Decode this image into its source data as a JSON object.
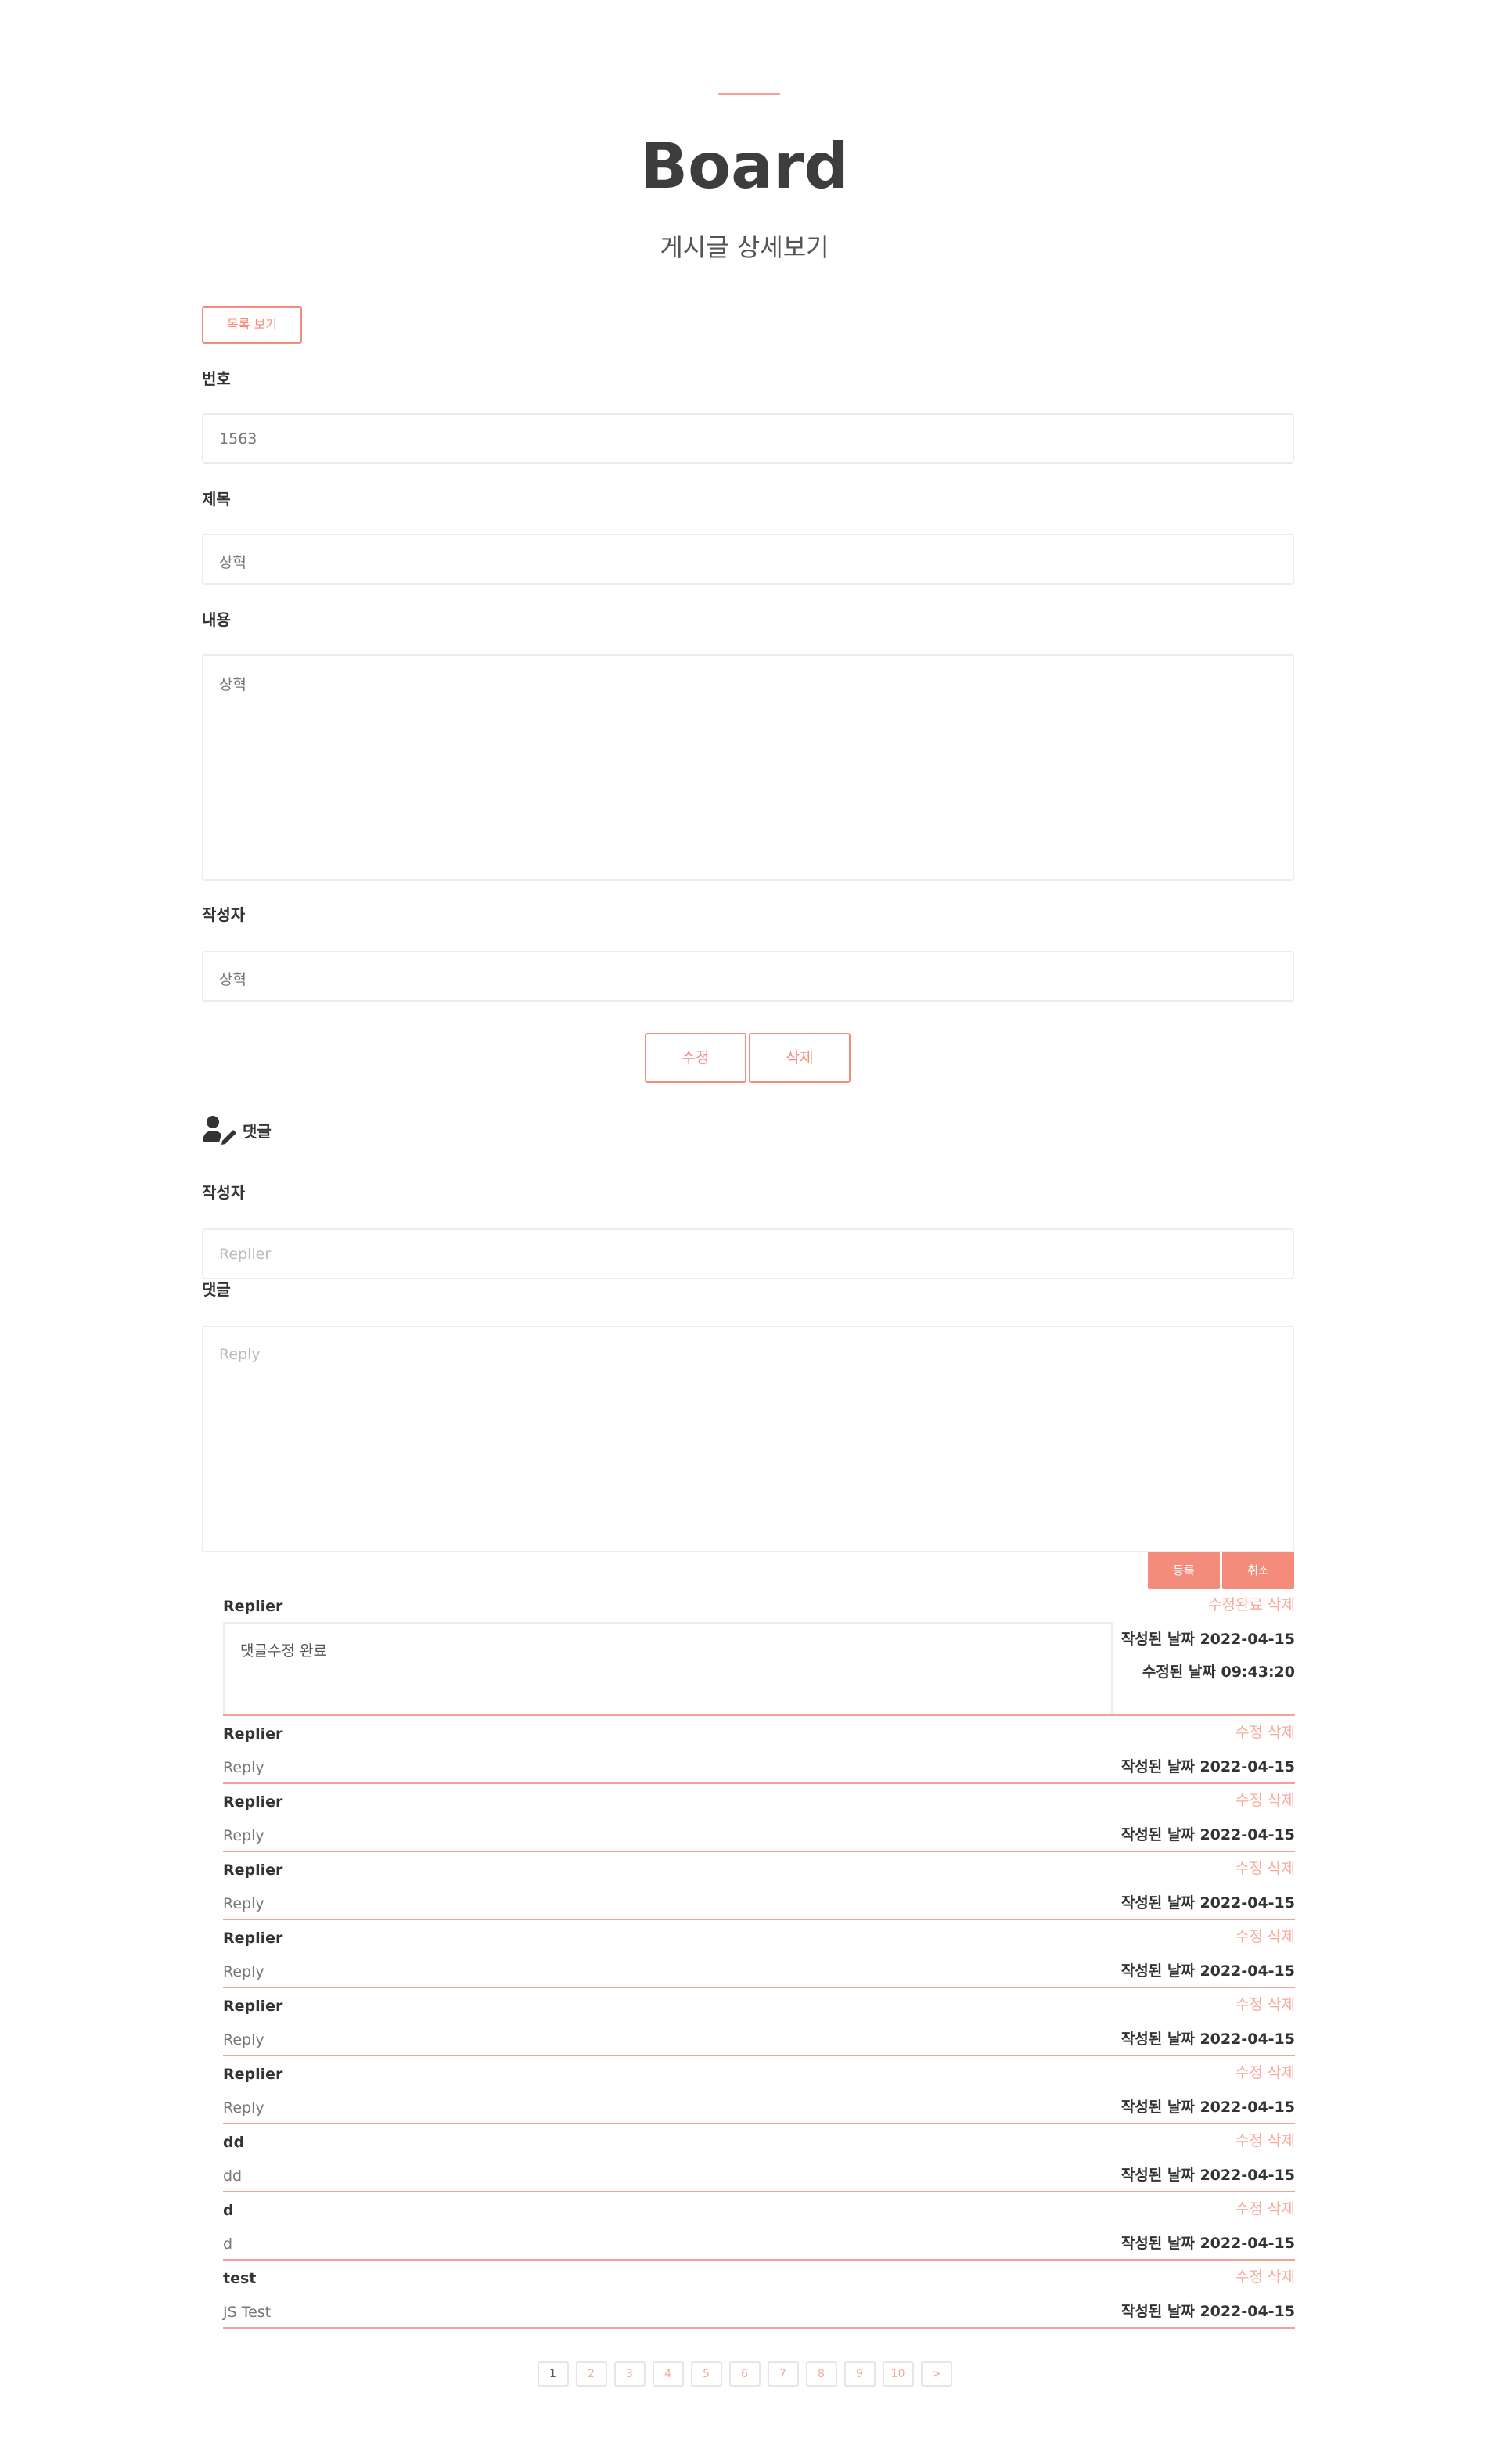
{
  "header": {
    "title": "Board",
    "subtitle": "게시글 상세보기",
    "accent_color": "#f4a295"
  },
  "toolbar": {
    "list_label": "목록 보기"
  },
  "post": {
    "number_label": "번호",
    "number_value": "1563",
    "title_label": "제목",
    "title_value": "상혁",
    "content_label": "내용",
    "content_value": "상혁",
    "writer_label": "작성자",
    "writer_value": "상혁",
    "edit_label": "수정",
    "delete_label": "삭제"
  },
  "reply_form": {
    "heading": "댓글",
    "heading_icon": "user-edit-icon",
    "writer_label": "작성자",
    "writer_placeholder": "Replier",
    "reply_label": "댓글",
    "reply_placeholder": "Reply",
    "submit_label": "등록",
    "cancel_label": "취소"
  },
  "editing_reply": {
    "name": "Replier",
    "confirm_label": "수정완료",
    "delete_label": "삭제",
    "content": "댓글수정 완료",
    "created_label": "작성된 날짜 2022-04-15",
    "modified_label": "수정된 날짜 09:43:20"
  },
  "replies": [
    {
      "name": "Replier",
      "text": "Reply",
      "date": "작성된 날짜 2022-04-15",
      "edit": "수정",
      "delete": "삭제"
    },
    {
      "name": "Replier",
      "text": "Reply",
      "date": "작성된 날짜 2022-04-15",
      "edit": "수정",
      "delete": "삭제"
    },
    {
      "name": "Replier",
      "text": "Reply",
      "date": "작성된 날짜 2022-04-15",
      "edit": "수정",
      "delete": "삭제"
    },
    {
      "name": "Replier",
      "text": "Reply",
      "date": "작성된 날짜 2022-04-15",
      "edit": "수정",
      "delete": "삭제"
    },
    {
      "name": "Replier",
      "text": "Reply",
      "date": "작성된 날짜 2022-04-15",
      "edit": "수정",
      "delete": "삭제"
    },
    {
      "name": "Replier",
      "text": "Reply",
      "date": "작성된 날짜 2022-04-15",
      "edit": "수정",
      "delete": "삭제"
    },
    {
      "name": "dd",
      "text": "dd",
      "date": "작성된 날짜 2022-04-15",
      "edit": "수정",
      "delete": "삭제"
    },
    {
      "name": "d",
      "text": "d",
      "date": "작성된 날짜 2022-04-15",
      "edit": "수정",
      "delete": "삭제"
    },
    {
      "name": "test",
      "text": "JS Test",
      "date": "작성된 날짜 2022-04-15",
      "edit": "수정",
      "delete": "삭제"
    }
  ],
  "pagination": {
    "pages": [
      "1",
      "2",
      "3",
      "4",
      "5",
      "6",
      "7",
      "8",
      "9",
      "10"
    ],
    "next": ">",
    "current": "1"
  }
}
